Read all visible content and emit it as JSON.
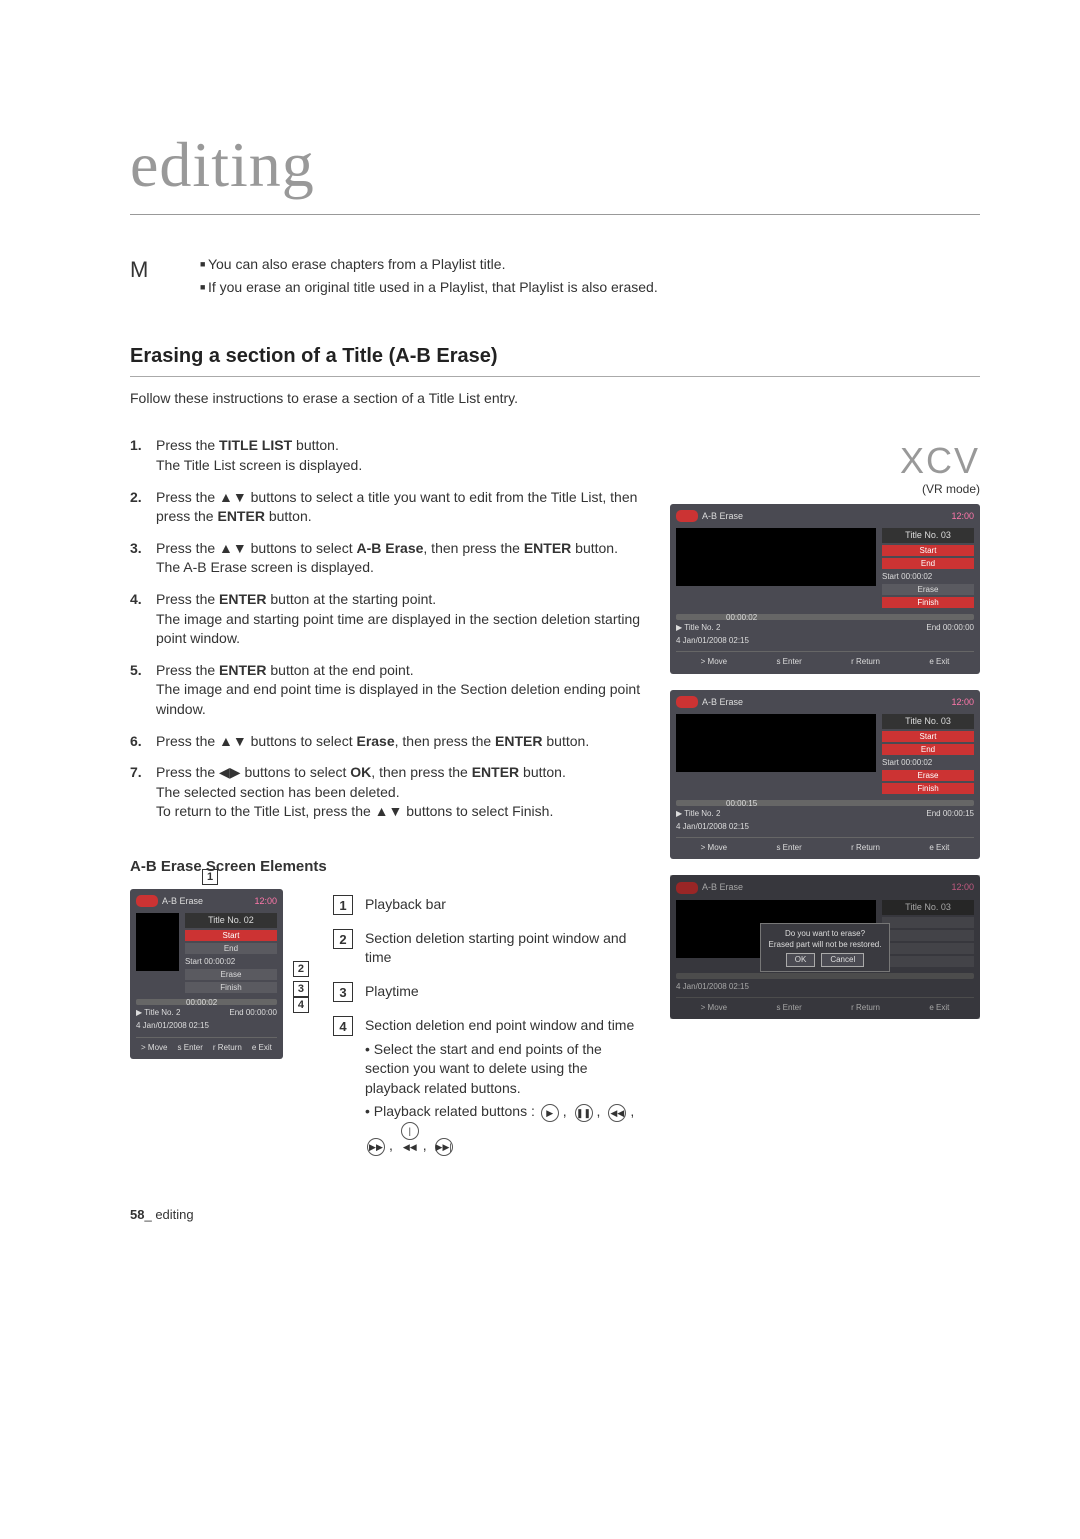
{
  "chapter_title": "editing",
  "note_mark": "M",
  "notes": [
    "You can also erase chapters from a Playlist title.",
    "If you erase an original title used in a Playlist, that Playlist is also erased."
  ],
  "section_heading": "Erasing a section of a Title (A-B Erase)",
  "section_intro": "Follow these instructions to erase a section of a Title List entry.",
  "xcv": "XCV",
  "vr_mode": "(VR mode)",
  "steps": [
    {
      "num": "1.",
      "html": "Press the <b>TITLE LIST</b> button.<br>The Title List screen is displayed."
    },
    {
      "num": "2.",
      "html": "Press the ▲▼ buttons to select a title you want to edit from the Title List, then press the <b>ENTER</b> button."
    },
    {
      "num": "3.",
      "html": "Press the ▲▼ buttons to select <b>A-B Erase</b>, then press the <b>ENTER</b> button.<br>The A-B Erase screen is displayed."
    },
    {
      "num": "4.",
      "html": "Press the <b>ENTER</b> button at the starting point.<br>The image and starting point time are displayed in the section deletion starting point window."
    },
    {
      "num": "5.",
      "html": "Press the <b>ENTER</b> button at the end point.<br>The image and end point time is displayed in the Section deletion ending point window."
    },
    {
      "num": "6.",
      "html": "Press the ▲▼ buttons to select <b>Erase</b>, then press the <b>ENTER</b> button."
    },
    {
      "num": "7.",
      "html": "Press the ◀▶ buttons to select <b>OK</b>, then press the <b>ENTER</b> button.<br>The selected section has been deleted.<br>To return to the Title List, press the ▲▼ buttons to select Finish."
    }
  ],
  "panel": {
    "title": "A-B Erase",
    "clock": "12:00",
    "titleno03": "Title No. 03",
    "titleno02": "Title No. 02",
    "start_btn": "Start",
    "end_btn": "End",
    "erase_btn": "Erase",
    "finish_btn": "Finish",
    "play_time1": "00:00:02",
    "play_time2": "00:00:15",
    "start_label": "Start 00:00:02",
    "end_label0": "End 00:00:00",
    "end_label15": "End 00:00:15",
    "meta_title": "Title No. 2",
    "meta_date": "4   Jan/01/2008  02:15",
    "modal_q": "Do you want to erase?",
    "modal_sub": "Erased part will not be restored.",
    "ok": "OK",
    "cancel": "Cancel",
    "legend_move": ">  Move",
    "legend_enter": "s  Enter",
    "legend_return": "r  Return",
    "legend_exit": "e  Exit"
  },
  "elements_heading": "A-B Erase Screen Elements",
  "elements": [
    {
      "num": "1",
      "text": "Playback bar"
    },
    {
      "num": "2",
      "text": "Section deletion starting point window and time"
    },
    {
      "num": "3",
      "text": "Playtime"
    },
    {
      "num": "4",
      "text": "Section deletion end point window and time",
      "sub1_prefix": "• Select the start and end points of the section you want to delete using the playback related buttons.",
      "sub2": "• Playback related buttons :"
    }
  ],
  "footer": {
    "num": "58",
    "sep": "_ ",
    "label": "editing"
  }
}
